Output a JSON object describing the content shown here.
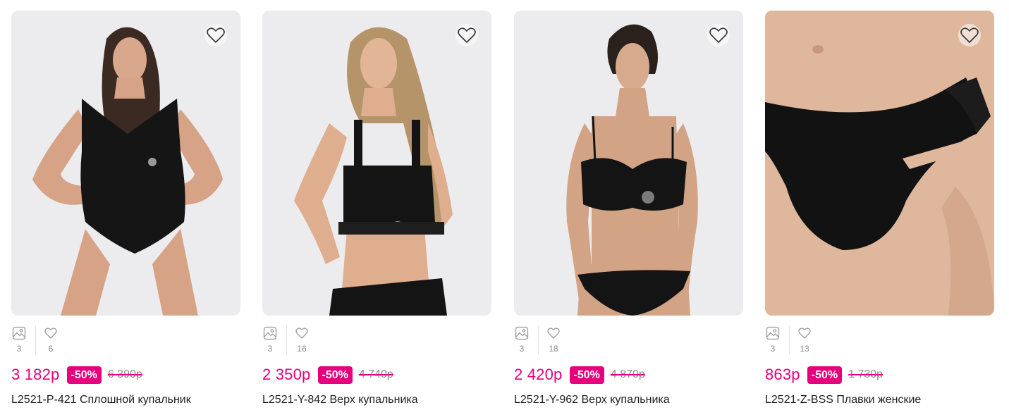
{
  "colors": {
    "accent": "#e6007e",
    "muted": "#8a8a8a",
    "photo_bg": "#eeeeef"
  },
  "icons": {
    "favorite": "heart-icon",
    "photos": "image-icon",
    "likes": "heart-outline-icon"
  },
  "products": [
    {
      "photo_count": "3",
      "like_count": "6",
      "price": "3 182р",
      "discount": "-50%",
      "old_price": "6 390р",
      "title": "L2521-P-421 Сплошной купальник"
    },
    {
      "photo_count": "3",
      "like_count": "16",
      "price": "2 350р",
      "discount": "-50%",
      "old_price": "4 740р",
      "title": "L2521-Y-842 Верх купальника"
    },
    {
      "photo_count": "3",
      "like_count": "18",
      "price": "2 420р",
      "discount": "-50%",
      "old_price": "4 870р",
      "title": "L2521-Y-962 Верх купальника"
    },
    {
      "photo_count": "3",
      "like_count": "13",
      "price": "863р",
      "discount": "-50%",
      "old_price": "1 730р",
      "title": "L2521-Z-BSS Плавки женские"
    }
  ]
}
